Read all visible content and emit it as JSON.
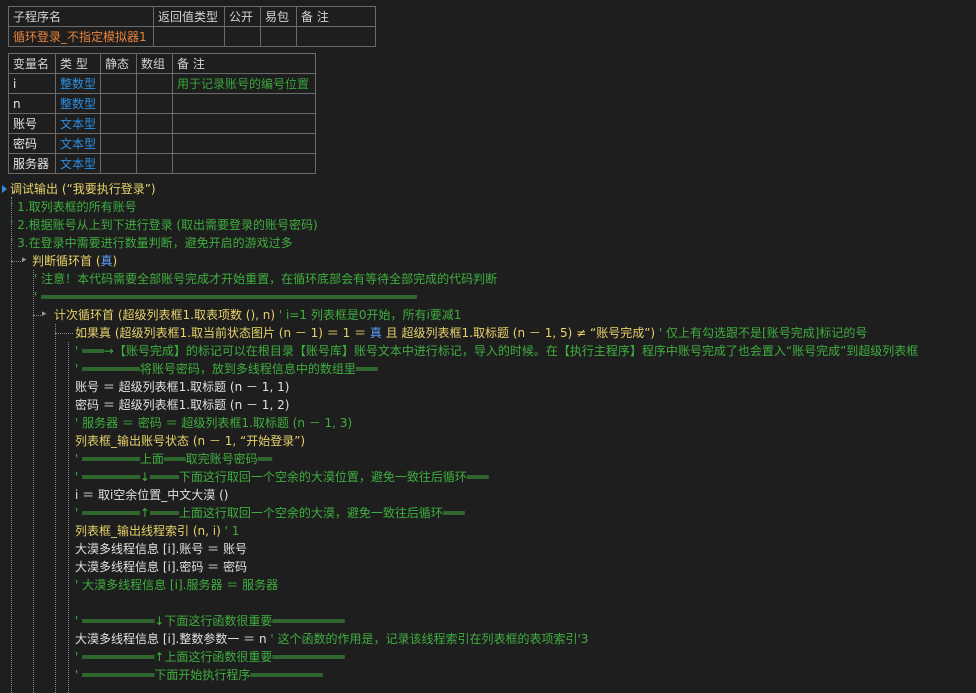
{
  "sub_table": {
    "headers": [
      "子程序名",
      "返回值类型",
      "公开",
      "易包",
      "备 注"
    ],
    "row": [
      "循环登录_不指定模拟器1",
      "",
      "",
      "",
      ""
    ]
  },
  "var_table": {
    "headers": [
      "变量名",
      "类 型",
      "静态",
      "数组",
      "备 注"
    ],
    "rows": [
      [
        "i",
        "整数型",
        "",
        "",
        "用于记录账号的编号位置"
      ],
      [
        "n",
        "整数型",
        "",
        "",
        ""
      ],
      [
        "账号",
        "文本型",
        "",
        "",
        ""
      ],
      [
        "密码",
        "文本型",
        "",
        "",
        ""
      ],
      [
        "服务器",
        "文本型",
        "",
        "",
        ""
      ]
    ]
  },
  "code": {
    "l1": "调试输出 (“我要执行登录”)",
    "l2": "' 1.取列表框的所有账号",
    "l3": "' 2.根据账号从上到下进行登录 (取出需要登录的账号密码)",
    "l4": "' 3.在登录中需要进行数量判断，避免开启的游戏过多",
    "l5a": "判断循环首 (",
    "l5b": "真",
    "l5c": ")",
    "l6": "' 注意！本代码需要全部账号完成才开始重置，在循环底部会有等待全部完成的代码判断",
    "l7": "' ════════════════════════════════════════════════════",
    "l8a": "计次循环首 (超级列表框1.取表项数 (), n)",
    "l8b": "' i=1  列表框是0开始，所有i要减1",
    "l9a": "如果真 (超级列表框1.取当前状态图片 (n － 1) ＝ 1 ＝ ",
    "l9b": "真",
    "l9c": " 且 超级列表框1.取标题 (n － 1, 5) ≠ “账号完成”)",
    "l9d": "' 仅上有勾选跟不是[账号完成]标记的号",
    "l10": "' ═══→【账号完成】的标记可以在根目录【账号库】账号文本中进行标记，导入的时候。在【执行主程序】程序中账号完成了也会置入“账号完成”到超级列表框",
    "l11": "' ════════将账号密码，放到多线程信息中的数组里═══",
    "l12": "账号 ＝ 超级列表框1.取标题 (n － 1, 1)",
    "l13": "密码 ＝ 超级列表框1.取标题 (n － 1, 2)",
    "l14": "' 服务器 ＝ 密码 ＝ 超级列表框1.取标题 (n － 1, 3)",
    "l15": "列表框_输出账号状态 (n － 1, “开始登录”)",
    "l16": "' ════════上面═══取完账号密码══",
    "l17": "' ════════↓════下面这行取回一个空余的大漠位置，避免一致往后循环═══",
    "l18": "i ＝ 取i空余位置_中文大漠 ()",
    "l19": "' ════════↑════上面这行取回一个空余的大漠，避免一致往后循环═══",
    "l20a": "列表框_输出线程索引 (n, i)",
    "l20b": "' 1",
    "l21": "大漠多线程信息 [i].账号 ＝ 账号",
    "l22": "大漠多线程信息 [i].密码 ＝ 密码",
    "l23": "' 大漠多线程信息 [i].服务器 ＝ 服务器",
    "l24": "' ══════════↓下面这行函数很重要══════════",
    "l25a": "大漠多线程信息 [i].整数参数一 ＝ n",
    "l25b": "' 这个函数的作用是，记录该线程索引在列表框的表项索引'3",
    "l26": "' ══════════↑上面这行函数很重要══════════",
    "l27": "' ══════════下面开始执行程序══════════"
  }
}
